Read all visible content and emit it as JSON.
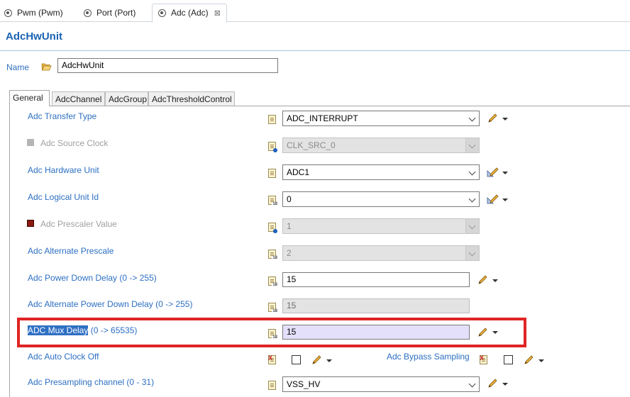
{
  "editor_tabs": [
    {
      "label": "Pwm (Pwm)"
    },
    {
      "label": "Port (Port)"
    },
    {
      "label": "Adc (Adc)",
      "close": "⊠"
    }
  ],
  "header": {
    "title": "AdcHwUnit"
  },
  "name_field": {
    "label": "Name",
    "value": "AdcHwUnit"
  },
  "sub_tabs": [
    {
      "label": "General"
    },
    {
      "label": "AdcChannel"
    },
    {
      "label": "AdcGroup"
    },
    {
      "label": "AdcThresholdControl"
    }
  ],
  "rows": {
    "transfer_type": {
      "label": "Adc Transfer Type",
      "value": "ADC_INTERRUPT"
    },
    "source_clock": {
      "label": "Adc Source Clock",
      "value": "CLK_SRC_0"
    },
    "hardware_unit": {
      "label": "Adc Hardware Unit",
      "value": "ADC1"
    },
    "logical_unit_id": {
      "label": "Adc Logical Unit Id",
      "value": "0"
    },
    "prescaler_value": {
      "label": "Adc Prescaler Value",
      "value": "1"
    },
    "alternate_prescale": {
      "label": "Adc Alternate Prescale",
      "value": "2"
    },
    "power_down_delay": {
      "label": "Adc Power Down Delay (0 -> 255)",
      "value": "15"
    },
    "alt_power_down_delay": {
      "label": "Adc Alternate Power Down Delay (0 -> 255)",
      "value": "15"
    },
    "mux_delay": {
      "label_highlight": "ADC Mux Delay",
      "label_range": " (0 -> 65535)",
      "value": "15"
    },
    "auto_clock_off": {
      "label": "Adc Auto Clock Off",
      "checked": false
    },
    "bypass_sampling": {
      "label": "Adc Bypass Sampling",
      "checked": false
    },
    "presampling_channel": {
      "label": "Adc Presampling channel (0 - 31)",
      "value": "VSS_HV"
    }
  },
  "icons": {
    "editor_tab": "gear-doc-icon",
    "folder": "folder-icon",
    "param": "param-doc-icon",
    "edit": "pencil-icon",
    "menu": "caret-down-icon"
  },
  "colors": {
    "link_blue": "#2c6fc2",
    "title_blue": "#1a63b3",
    "highlight": "#2f70c4",
    "mux_field_bg": "#e4e0fb",
    "callout_red": "#e02424"
  }
}
